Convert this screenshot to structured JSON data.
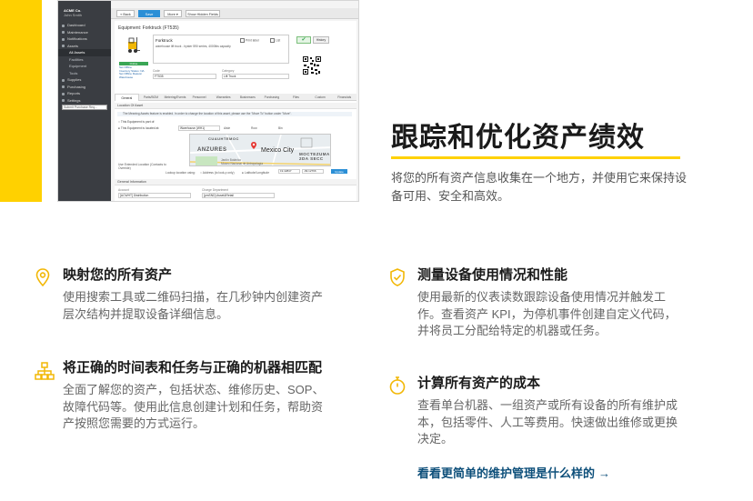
{
  "brand": {
    "accent": "#FFD100",
    "link_color": "#0d4f7a"
  },
  "app": {
    "sidebar": {
      "company": "ACME Co.",
      "user": "John Smith",
      "items": [
        {
          "label": "Dashboard",
          "sub": false
        },
        {
          "label": "Maintenance",
          "sub": false
        },
        {
          "label": "Notifications",
          "sub": false
        },
        {
          "label": "Assets",
          "sub": false
        },
        {
          "label": "All Assets",
          "sub": true,
          "active": true
        },
        {
          "label": "Facilities",
          "sub": true
        },
        {
          "label": "Equipment",
          "sub": true
        },
        {
          "label": "Tools",
          "sub": true
        },
        {
          "label": "Supplies",
          "sub": false
        },
        {
          "label": "Purchasing",
          "sub": false
        },
        {
          "label": "Reports",
          "sub": false
        },
        {
          "label": "Settings",
          "sub": false
        }
      ],
      "search_placeholder": "Submit Purchase Req..."
    },
    "toolbar": {
      "back": "« Back",
      "save": "Save",
      "more": "More ▾",
      "show": "Show Hidden Fields"
    },
    "equipment": {
      "header": "Equipment: Forktruck (FT535)",
      "name": "Forktruck",
      "description": "warehouse lift truck - hyster 590 series, 4000lbs capacity",
      "print_label": "Print label",
      "list_label": "List",
      "history_btn": "History",
      "status": "Online",
      "links": [
        "Set Offline",
        "Inventory Status: NA",
        "Set Offline Reason",
        "Warehouse"
      ],
      "code_label": "Code",
      "code_value": "FT535",
      "category_label": "Category",
      "category_value": "Lift Truck"
    },
    "tabs": [
      "General",
      "Parts/BOM",
      "Metering/Events",
      "Personnel",
      "Warranties",
      "Businesses",
      "Purchasing",
      "Files",
      "Custom",
      "Financials"
    ],
    "location_section": "Location Of Asset",
    "location_note": "The Meaning Assets feature is enabled. In order to change the location of this asset, please use the \"Move To\" button under \"More\".",
    "radio_a": "This Equipment is part of:",
    "radio_b": "This Equipment is located at:",
    "radio_b_value": "Warehouse (WH1)",
    "aisle_label": "Aisle",
    "row_label": "Row",
    "bin_label": "Bin",
    "map": {
      "area1": "CUAUHTEMOC",
      "area2": "ANZURES",
      "city": "Mexico City",
      "area3": "MOCTEZUMA 2DA SECC",
      "small1": "Jardín Botánico",
      "small2": "Museo Nacional de Antropología"
    },
    "extended_label": "Use Extended Location (Contacts to Override)",
    "lookup_label": "Lookup location using:",
    "lookup_a": "Address (to look-p only)",
    "lookup_b": "Latitude/Longitude",
    "lat_value": "19.42847",
    "lng_value": "-99.12766",
    "update_btn": "Update Map",
    "general_section": "General Information",
    "account_label": "Account",
    "account_value": "[ACWHT] Distribution",
    "dept_label": "Charge Department",
    "dept_value": "[pmSND] Asset&Retail"
  },
  "hero": {
    "title": "跟踪和优化资产绩效",
    "text": "将您的所有资产信息收集在一个地方，并使用它来保持设备可用、安全和高效。"
  },
  "features": [
    {
      "icon": "map-pin-icon",
      "title": "映射您的所有资产",
      "text": "使用搜索工具或二维码扫描，在几秒钟内创建资产层次结构并提取设备详细信息。"
    },
    {
      "icon": "shield-check-icon",
      "title": "测量设备使用情况和性能",
      "text": "使用最新的仪表读数跟踪设备使用情况并触发工作。查看资产 KPI，为停机事件创建自定义代码，并将员工分配给特定的机器或任务。"
    },
    {
      "icon": "hierarchy-icon",
      "title": "将正确的时间表和任务与正确的机器相匹配",
      "text": "全面了解您的资产，包括状态、维修历史、SOP、故障代码等。使用此信息创建计划和任务，帮助资产按照您需要的方式运行。"
    },
    {
      "icon": "stopwatch-icon",
      "title": "计算所有资产的成本",
      "text": "查看单台机器、一组资产或所有设备的所有维护成本，包括零件、人工等费用。快速做出维修或更换决定。"
    }
  ],
  "cta": {
    "label": "看看更简单的维护管理是什么样的",
    "arrow": "→"
  }
}
